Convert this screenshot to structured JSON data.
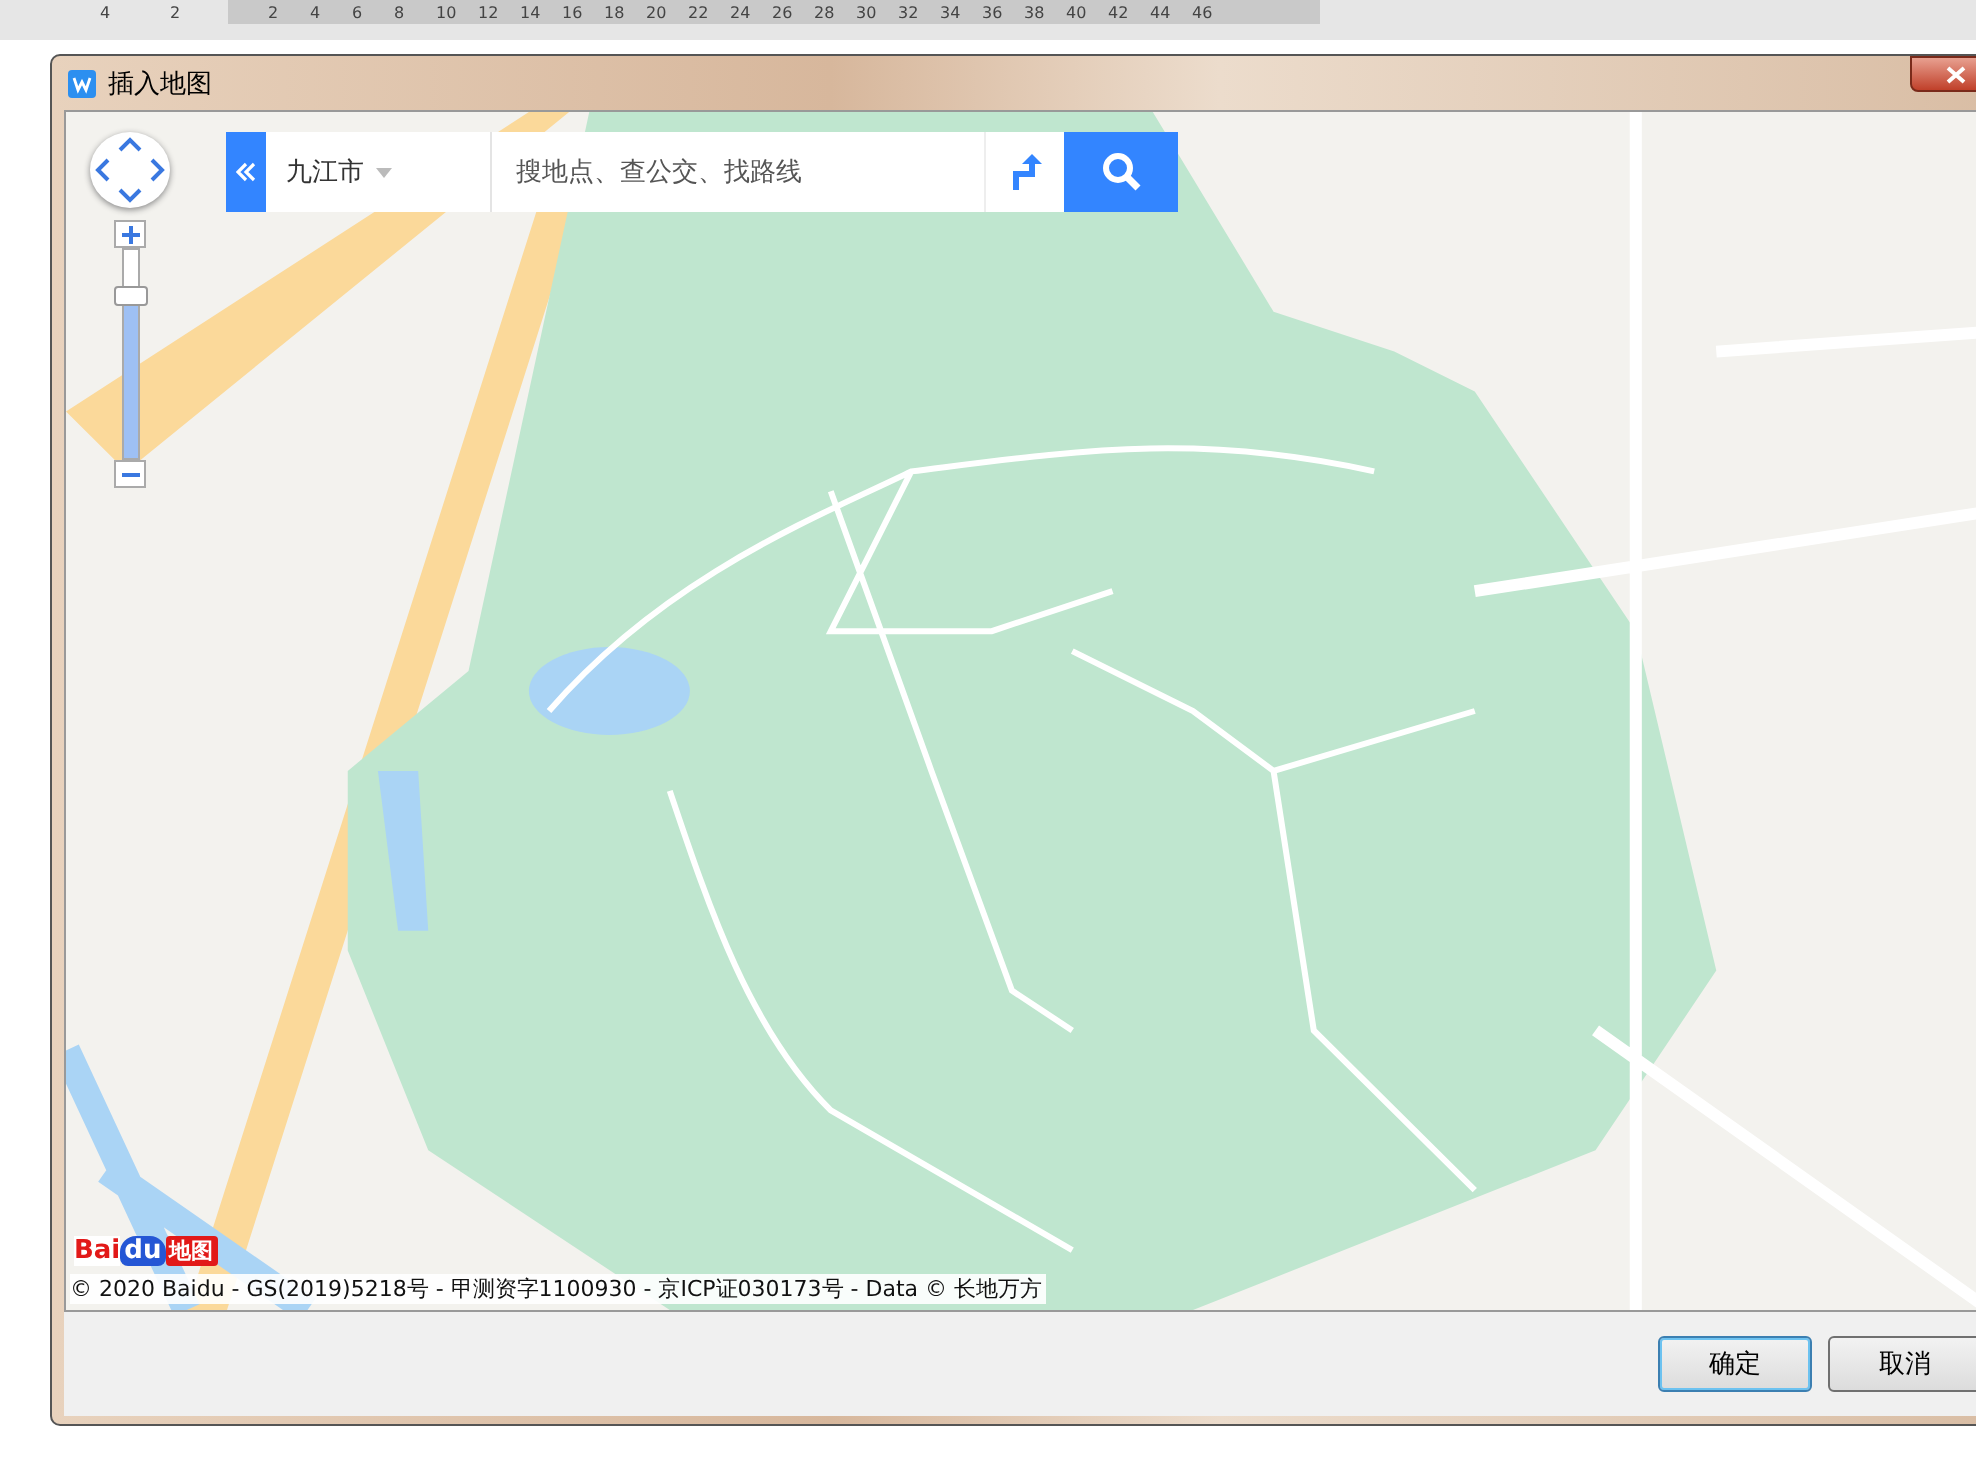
{
  "ruler": {
    "left_ticks": [
      "4",
      "2"
    ],
    "ticks": [
      "2",
      "4",
      "6",
      "8",
      "10",
      "12",
      "14",
      "16",
      "18",
      "20",
      "22",
      "24",
      "26",
      "28",
      "30",
      "32",
      "34",
      "36",
      "38",
      "40",
      "42",
      "44",
      "46"
    ]
  },
  "dialog": {
    "title": "插入地图"
  },
  "zoom_slider": {
    "level": 0.78
  },
  "search_bar": {
    "city": "九江市",
    "placeholder": "搜地点、查公交、找路线"
  },
  "map": {
    "logo": [
      "Bai",
      "du",
      "地图"
    ],
    "copyright": "© 2020 Baidu - GS(2019)5218号 - 甲测资字1100930 - 京ICP证030173号 - Data © 长地万方"
  },
  "buttons": [
    {
      "label": "确定",
      "kind": "default"
    },
    {
      "label": "取消",
      "kind": "normal"
    }
  ]
}
